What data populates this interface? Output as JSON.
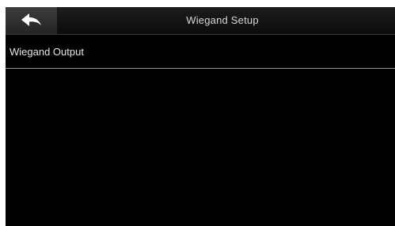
{
  "header": {
    "title": "Wiegand Setup",
    "back_icon": "back-arrow-icon"
  },
  "menu": {
    "items": [
      {
        "label": "Wiegand Output"
      }
    ]
  },
  "colors": {
    "background": "#000000",
    "text": "#e6e6e6",
    "divider": "#9a9a9a"
  }
}
